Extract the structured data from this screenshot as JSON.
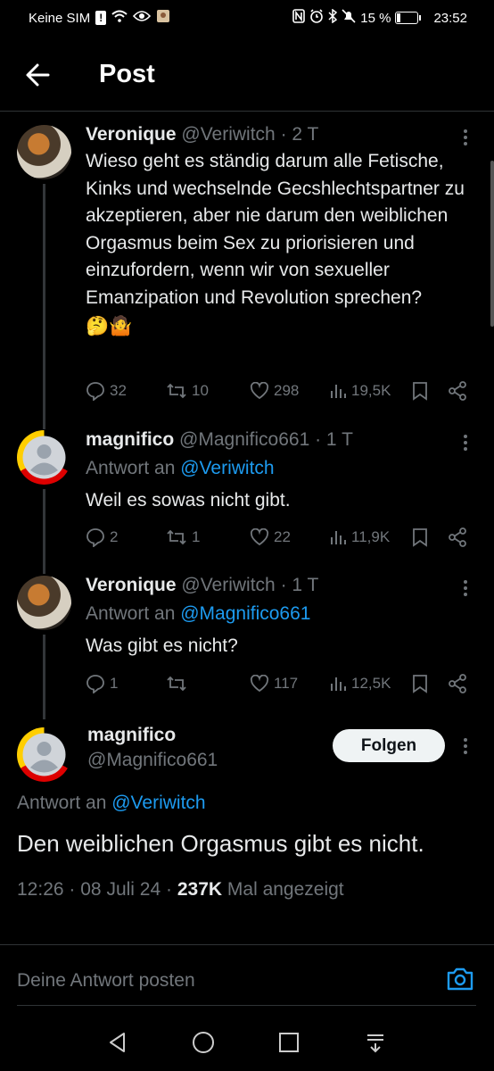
{
  "status_bar": {
    "carrier": "Keine SIM",
    "battery": "15 %",
    "time": "23:52"
  },
  "header": {
    "title": "Post"
  },
  "thread": [
    {
      "name": "Veronique",
      "handle": "@Veriwitch",
      "age": "· 2 T",
      "reply_to_label": "",
      "reply_to": "",
      "text": "Wieso geht es ständig darum alle Fetische, Kinks und wechselnde Gecshlechtspartner zu akzeptieren, aber nie darum den weiblichen Orgasmus beim Sex zu priorisieren und einzufordern, wenn wir von sexueller Emanzipation und Revolution sprechen?",
      "emoji": "🤔🤷",
      "replies": "32",
      "reposts": "10",
      "likes": "298",
      "views": "19,5K"
    },
    {
      "name": "magnifico",
      "handle": "@Magnifico661",
      "age": "· 1 T",
      "reply_to_label": "Antwort an",
      "reply_to": "@Veriwitch",
      "text": "Weil es sowas nicht gibt.",
      "replies": "2",
      "reposts": "1",
      "likes": "22",
      "views": "11,9K"
    },
    {
      "name": "Veronique",
      "handle": "@Veriwitch",
      "age": "· 1 T",
      "reply_to_label": "Antwort an",
      "reply_to": "@Magnifico661",
      "text": "Was gibt es nicht?",
      "replies": "1",
      "reposts": "",
      "likes": "117",
      "views": "12,5K"
    }
  ],
  "main_post": {
    "name": "magnifico",
    "handle": "@Magnifico661",
    "follow_label": "Folgen",
    "reply_to_label": "Antwort an",
    "reply_to": "@Veriwitch",
    "text": "Den weiblichen Orgasmus gibt es nicht.",
    "time": "12:26",
    "date": "08 Juli 24",
    "views_count": "237K",
    "views_label": "Mal angezeigt"
  },
  "reply_box": {
    "placeholder": "Deine Antwort posten"
  },
  "colors": {
    "background": "#000000",
    "text": "#e7e9ea",
    "muted": "#71767b",
    "link": "#1d9bf0",
    "divider": "#2f3336"
  }
}
